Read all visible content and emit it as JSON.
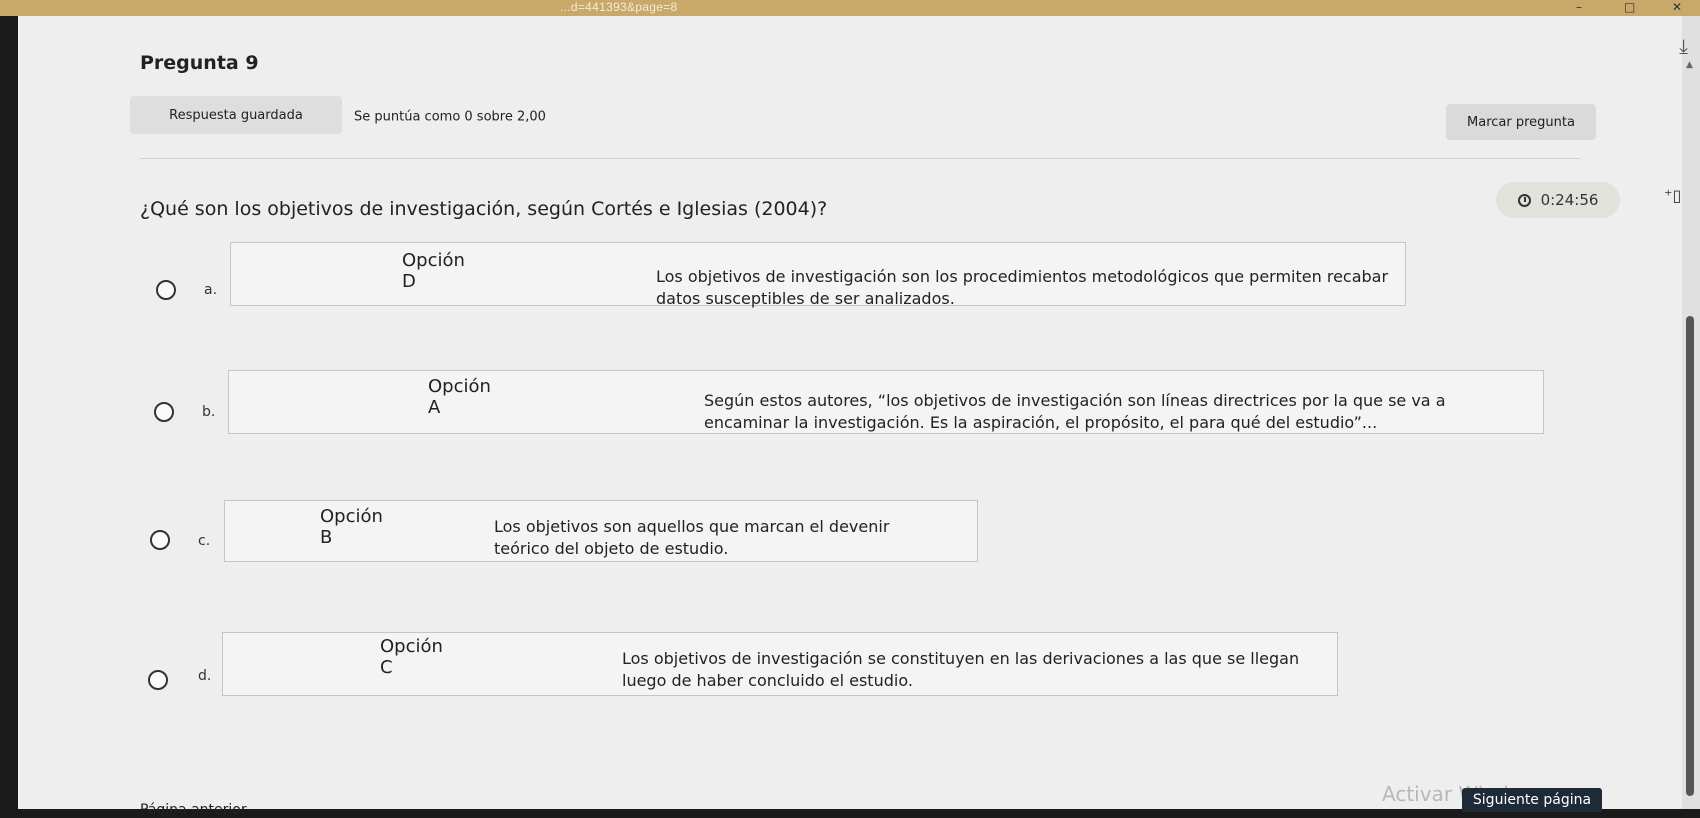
{
  "browser": {
    "url_fragment": "...d=441393&page=8"
  },
  "question": {
    "title": "Pregunta 9",
    "status_saved": "Respuesta guardada",
    "score": "Se puntúa como 0 sobre 2,00",
    "flag_label": "Marcar pregunta",
    "timer": "0:24:56",
    "text": "¿Qué son los objetivos de investigación, según Cortés e Iglesias (2004)?"
  },
  "options": [
    {
      "letter": "a.",
      "label": "Opción D",
      "text": "Los objetivos de investigación son los procedimientos metodológicos que permiten recabar datos susceptibles de ser analizados."
    },
    {
      "letter": "b.",
      "label": "Opción A",
      "text": "Según estos autores, “los objetivos de investigación son líneas directrices por la que se va a encaminar la investigación. Es la aspiración, el propósito, el para qué del estudio”..."
    },
    {
      "letter": "c.",
      "label": "Opción B",
      "text": "Los objetivos son aquellos que marcan el devenir teórico del objeto de estudio."
    },
    {
      "letter": "d.",
      "label": "Opción C",
      "text": "Los objetivos de investigación se constituyen en las derivaciones a las que se llegan luego de haber concluido el estudio."
    }
  ],
  "navigation": {
    "prev": "Página anterior",
    "next": "Siguiente página"
  },
  "watermark": "Activar Windows",
  "icons": {
    "timer": "clock-icon",
    "download": "download-icon",
    "hide_timer": "hide-icon"
  }
}
